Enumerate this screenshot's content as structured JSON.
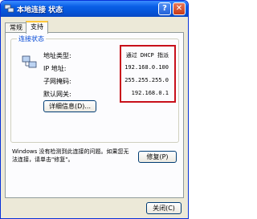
{
  "window": {
    "title": "本地连接 状态",
    "help_glyph": "?",
    "close_glyph": "✕"
  },
  "tabs": [
    {
      "label": "常规"
    },
    {
      "label": "支持"
    }
  ],
  "connection_status": {
    "group_label": "连接状态",
    "rows": [
      {
        "label": "地址类型:",
        "value": "通过 DHCP 指派"
      },
      {
        "label": "IP 地址:",
        "value": "192.168.0.100"
      },
      {
        "label": "子网掩码:",
        "value": "255.255.255.0"
      },
      {
        "label": "默认网关:",
        "value": "192.168.0.1"
      }
    ],
    "details_button": "详细信息(D)...",
    "highlight_color": "#c8101a"
  },
  "repair": {
    "description": "Windows 没有检测到此连接的问题。如果您无法连接，请单击\"修复\"。",
    "button": "修复(P)"
  },
  "footer": {
    "close_button": "关闭(C)"
  }
}
